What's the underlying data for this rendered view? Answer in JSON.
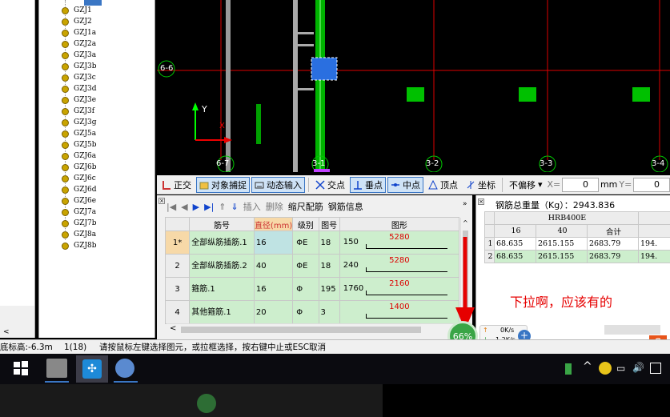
{
  "tree": {
    "items": [
      "GZJ1",
      "GZJ2",
      "GZJ1a",
      "GZJ2a",
      "GZJ3a",
      "GZJ3b",
      "GZJ3c",
      "GZJ3d",
      "GZJ3e",
      "GZJ3f",
      "GZJ3g",
      "GZJ5a",
      "GZJ5b",
      "GZJ6a",
      "GZJ6b",
      "GZJ6c",
      "GZJ6d",
      "GZJ6e",
      "GZJ7a",
      "GZJ7b",
      "GZJ8a",
      "GZJ8b"
    ]
  },
  "canvas": {
    "axis_labels": {
      "h": "6-6",
      "a1": "6-7",
      "a2": "3-1",
      "a3": "3-2",
      "a4": "3-3",
      "a5": "3-4"
    },
    "y_axis": "Y",
    "x_axis": "X"
  },
  "toolbar": {
    "ortho": "正交",
    "snap": "对象捕捉",
    "dyn": "动态输入",
    "intersect": "交点",
    "perp": "垂点",
    "mid": "中点",
    "vertex": "顶点",
    "coord": "坐标",
    "offset": "不偏移",
    "x_label": "X=",
    "x_value": "0",
    "unit": "mm",
    "y_label": "Y=",
    "y_value": "0"
  },
  "subtoolbar": {
    "insert": "插入",
    "delete": "删除",
    "scale": "缩尺配筋",
    "info": "钢筋信息"
  },
  "rebar_table": {
    "headers": [
      "筋号",
      "直径(mm)",
      "级别",
      "图号",
      "图形"
    ],
    "rows": [
      {
        "num": "1*",
        "name": "全部纵筋插筋.1",
        "dia": "16",
        "grade": "ΦE",
        "fig": "18",
        "left": "150",
        "val": "5280"
      },
      {
        "num": "2",
        "name": "全部纵筋插筋.2",
        "dia": "40",
        "grade": "ΦE",
        "fig": "18",
        "left": "240",
        "val": "5280"
      },
      {
        "num": "3",
        "name": "箍筋.1",
        "dia": "16",
        "grade": "Φ",
        "fig": "195",
        "left": "1760",
        "val": "2160"
      },
      {
        "num": "4",
        "name": "其他箍筋.1",
        "dia": "20",
        "grade": "Φ",
        "fig": "3",
        "left": "",
        "val": "1400"
      }
    ]
  },
  "weight": {
    "title": "钢筋总重量（Kg）：2943.836",
    "group": "HRB400E",
    "cols": [
      "16",
      "40",
      "合计"
    ],
    "rows": [
      {
        "n": "1",
        "a": "68.635",
        "b": "2615.155",
        "c": "2683.79",
        "d": "194."
      },
      {
        "n": "2",
        "a": "68.635",
        "b": "2615.155",
        "c": "2683.79",
        "d": "194."
      }
    ]
  },
  "annotation": "下拉啊，应该有的",
  "netspeed": {
    "percent": "66%",
    "up": "0K/s",
    "down": "1.2K/s"
  },
  "status": {
    "elev": "底标高:-6.3m",
    "count": "1(18)",
    "hint": "请按鼠标左键选择图元，或拉框选择，按右键中止或ESC取消"
  },
  "colors": {
    "accent": "#3a76c4",
    "green": "#00c000",
    "red": "#e60000"
  }
}
